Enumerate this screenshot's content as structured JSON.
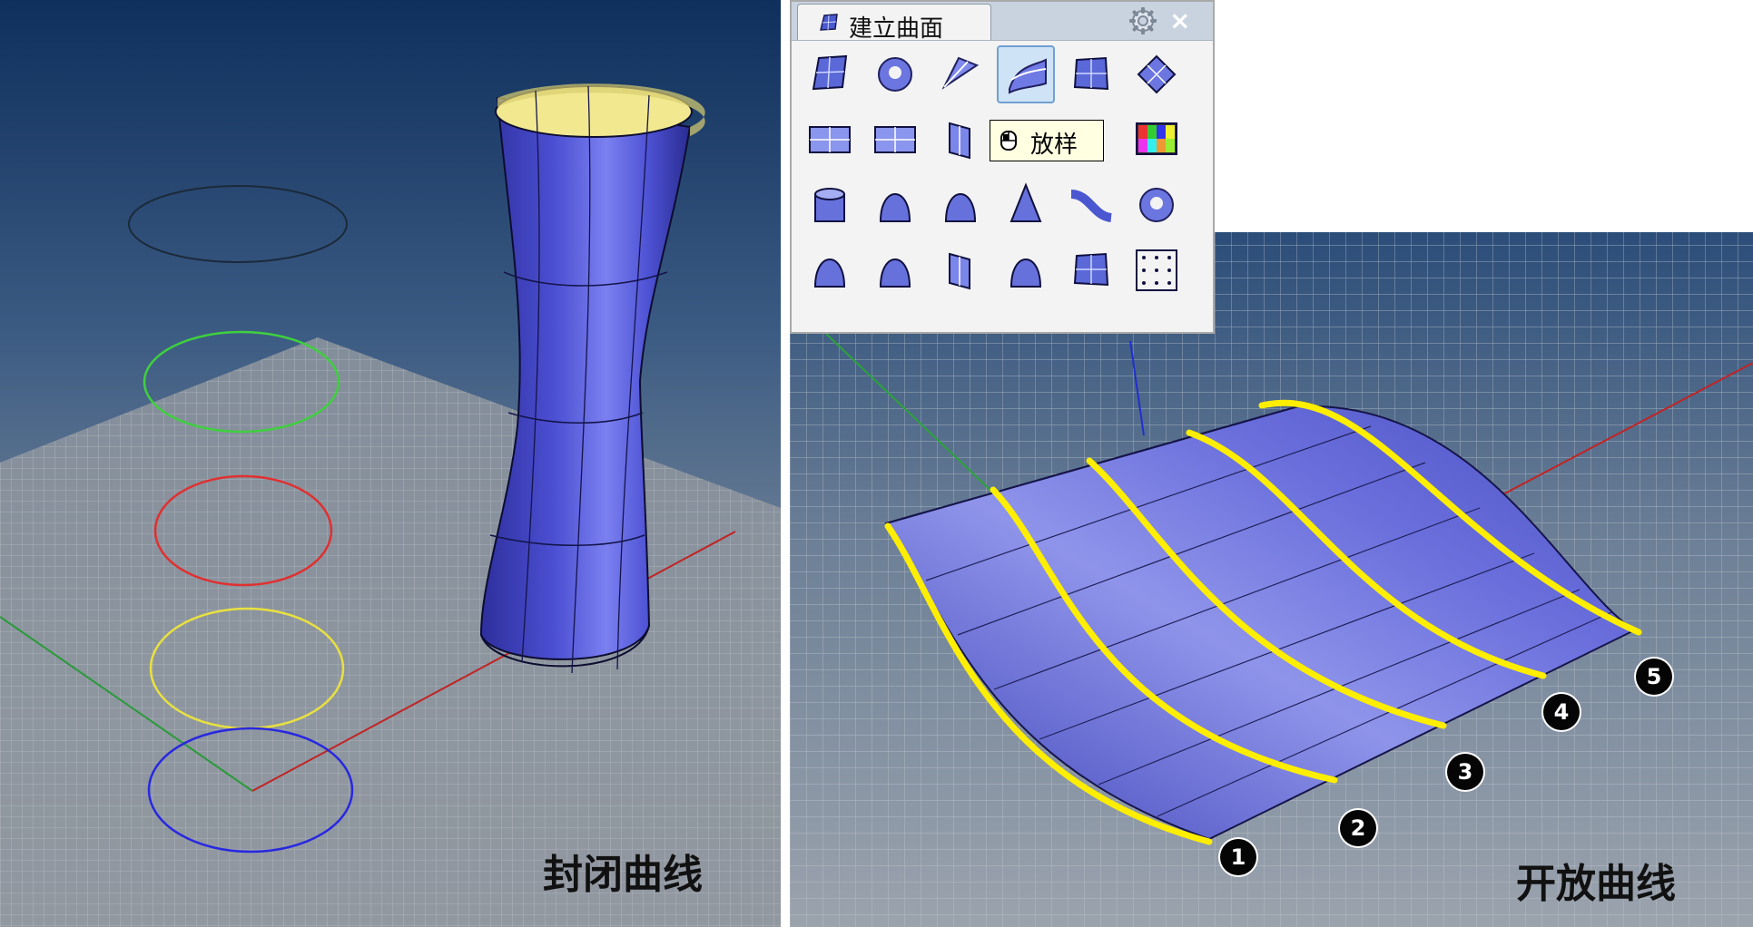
{
  "left_view": {
    "caption": "封闭曲线"
  },
  "right_view": {
    "caption": "开放曲线",
    "curve_markers": [
      "1",
      "2",
      "3",
      "4",
      "5"
    ]
  },
  "toolbar": {
    "title": "建立曲面",
    "tooltip": "放样",
    "tools": [
      [
        "surface-from-points-icon",
        "patch-icon",
        "sweep-rail-icon",
        "loft-icon",
        "edge-surface-icon",
        "network-surface-icon"
      ],
      [
        "plane-icon",
        "plane-3pt-icon",
        "vertical-plane-icon",
        "loft-active-icon",
        "extrude-icon",
        "heightfield-icon"
      ],
      [
        "extrude-curve-icon",
        "revolve-icon",
        "rail-revolve-icon",
        "cone-icon",
        "sweep-1-icon",
        "drape-icon"
      ],
      [
        "sweep-1-rail-icon",
        "sweep-2-rail-icon",
        "bend-icon",
        "blend-surface-icon",
        "patch-grid-icon",
        "point-grid-icon"
      ]
    ]
  },
  "colors": {
    "surface": "#5559d8",
    "curve_highlight": "#ffee00",
    "viewport_top": "#15325f",
    "viewport_bottom": "#9aa2ab"
  }
}
